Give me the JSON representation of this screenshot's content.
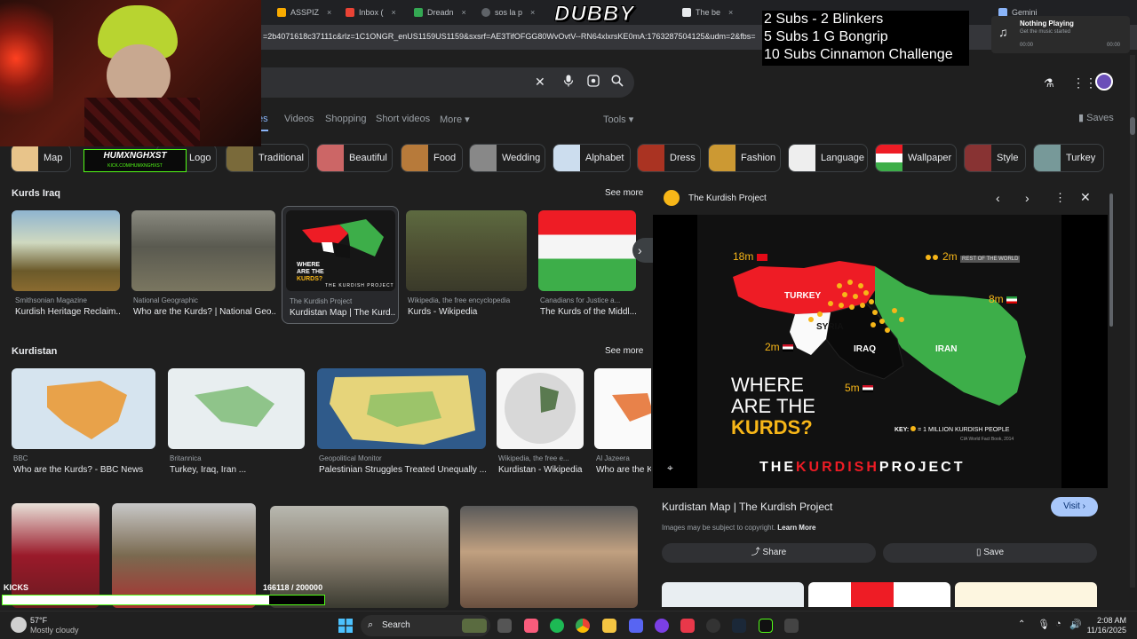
{
  "tabs": [
    {
      "label": "ASSPIZ",
      "color": "#f9ab00"
    },
    {
      "label": "Inbox (",
      "color": "#ea4335"
    },
    {
      "label": "Dreadn",
      "color": "#34a853"
    },
    {
      "label": "sos la p",
      "color": "#5f6368"
    },
    {
      "label": "The be",
      "color": "#e8eaed"
    },
    {
      "label": "Gemini",
      "color": "#8ab4f8"
    }
  ],
  "overlay_title": "DUBBY",
  "url": "=2b4071618c37111c&rlz=1C1ONGR_enUS1159US1159&sxsrf=AE3TifOFGG80WvOvtV--RN64xlxrsKE0mA:1763287504125&udm=2&fbs=",
  "subs_lines": [
    "2 Subs - 2 Blinkers",
    "5 Subs 1 G Bongrip",
    "10 Subs Cinnamon Challenge"
  ],
  "now_playing": {
    "title": "Nothing Playing",
    "subtitle": "Get the music started",
    "time_left": "00:00",
    "time_right": "00:00"
  },
  "webcam": {
    "kick_user": "HUMXNGHXST",
    "kick_url": "KICK.COM/HUMXNGHXST"
  },
  "filters": [
    "Videos",
    "Shopping",
    "Short videos",
    "More",
    "Tools"
  ],
  "filter_active_fragment": "es",
  "saves_label": "Saves",
  "chips": [
    {
      "label": "Map"
    },
    {
      "label": "Logo"
    },
    {
      "label": "Traditional"
    },
    {
      "label": "Beautiful"
    },
    {
      "label": "Food"
    },
    {
      "label": "Wedding"
    },
    {
      "label": "Alphabet"
    },
    {
      "label": "Dress"
    },
    {
      "label": "Fashion"
    },
    {
      "label": "Language"
    },
    {
      "label": "Wallpaper"
    },
    {
      "label": "Style"
    },
    {
      "label": "Turkey"
    }
  ],
  "sections": [
    {
      "title": "Kurds Iraq",
      "see_more": "See more",
      "items": [
        {
          "source": "Smithsonian Magazine",
          "caption": "Kurdish Heritage Reclaim..."
        },
        {
          "source": "National Geographic",
          "caption": "Who are the Kurds? | National Geo..."
        },
        {
          "source": "The Kurdish Project",
          "caption": "Kurdistan Map | The Kurd..."
        },
        {
          "source": "Wikipedia, the free encyclopedia",
          "caption": "Kurds - Wikipedia"
        },
        {
          "source": "Canadians for Justice a...",
          "caption": "The Kurds of the Middl..."
        }
      ]
    },
    {
      "title": "Kurdistan",
      "see_more": "See more",
      "items": [
        {
          "source": "BBC",
          "caption": "Who are the Kurds? - BBC News"
        },
        {
          "source": "Britannica",
          "caption": "Turkey, Iraq, Iran ..."
        },
        {
          "source": "Geopolitical Monitor",
          "caption": "Palestinian Struggles Treated Unequally ..."
        },
        {
          "source": "Wikipedia, the free e...",
          "caption": "Kurdistan - Wikipedia"
        },
        {
          "source": "Al Jazeera",
          "caption": "Who are the K"
        }
      ]
    }
  ],
  "thumb_map": {
    "title_line1": "WHERE",
    "title_line2": "ARE THE",
    "title_line3": "KURDS?",
    "brand": "THE KURDISH PROJECT"
  },
  "panel": {
    "source": "The Kurdish Project",
    "title": "Kurdistan Map | The Kurdish Project",
    "visit": "Visit",
    "copyright": "Images may be subject to copyright.",
    "learn_more": "Learn More",
    "share": "Share",
    "save": "Save",
    "map": {
      "labels": {
        "turkey": "TURKEY",
        "syria": "SYRIA",
        "iraq": "IRAQ",
        "iran": "IRAN"
      },
      "counts": {
        "turkey": "18m",
        "rest": "2m",
        "rest_label": "REST OF THE WORLD",
        "iran": "8m",
        "syria": "2m",
        "iraq": "5m"
      },
      "title_line1": "WHERE",
      "title_line2": "ARE THE",
      "title_line3": "KURDS?",
      "key": "KEY:",
      "key_text": "= 1 MILLION KURDISH PEOPLE",
      "key_source": "CIA World Fact Book, 2014",
      "brand_the": "THE",
      "brand_kurdish": "KURDISH",
      "brand_project": "PROJECT"
    }
  },
  "stream_bar": {
    "left": "KICKS",
    "progress": "166118 / 200000",
    "progress_fraction": 0.83
  },
  "taskbar": {
    "weather_temp": "57°F",
    "weather_desc": "Mostly cloudy",
    "search": "Search",
    "time": "2:08 AM",
    "date": "11/16/2025"
  },
  "colors": {
    "accent_blue": "#8ab4f8",
    "visit_bg": "#a8c7fa",
    "kick_green": "#53fc18",
    "map_red": "#ee1c25",
    "map_green": "#3dae49",
    "map_gold": "#f7b618"
  }
}
